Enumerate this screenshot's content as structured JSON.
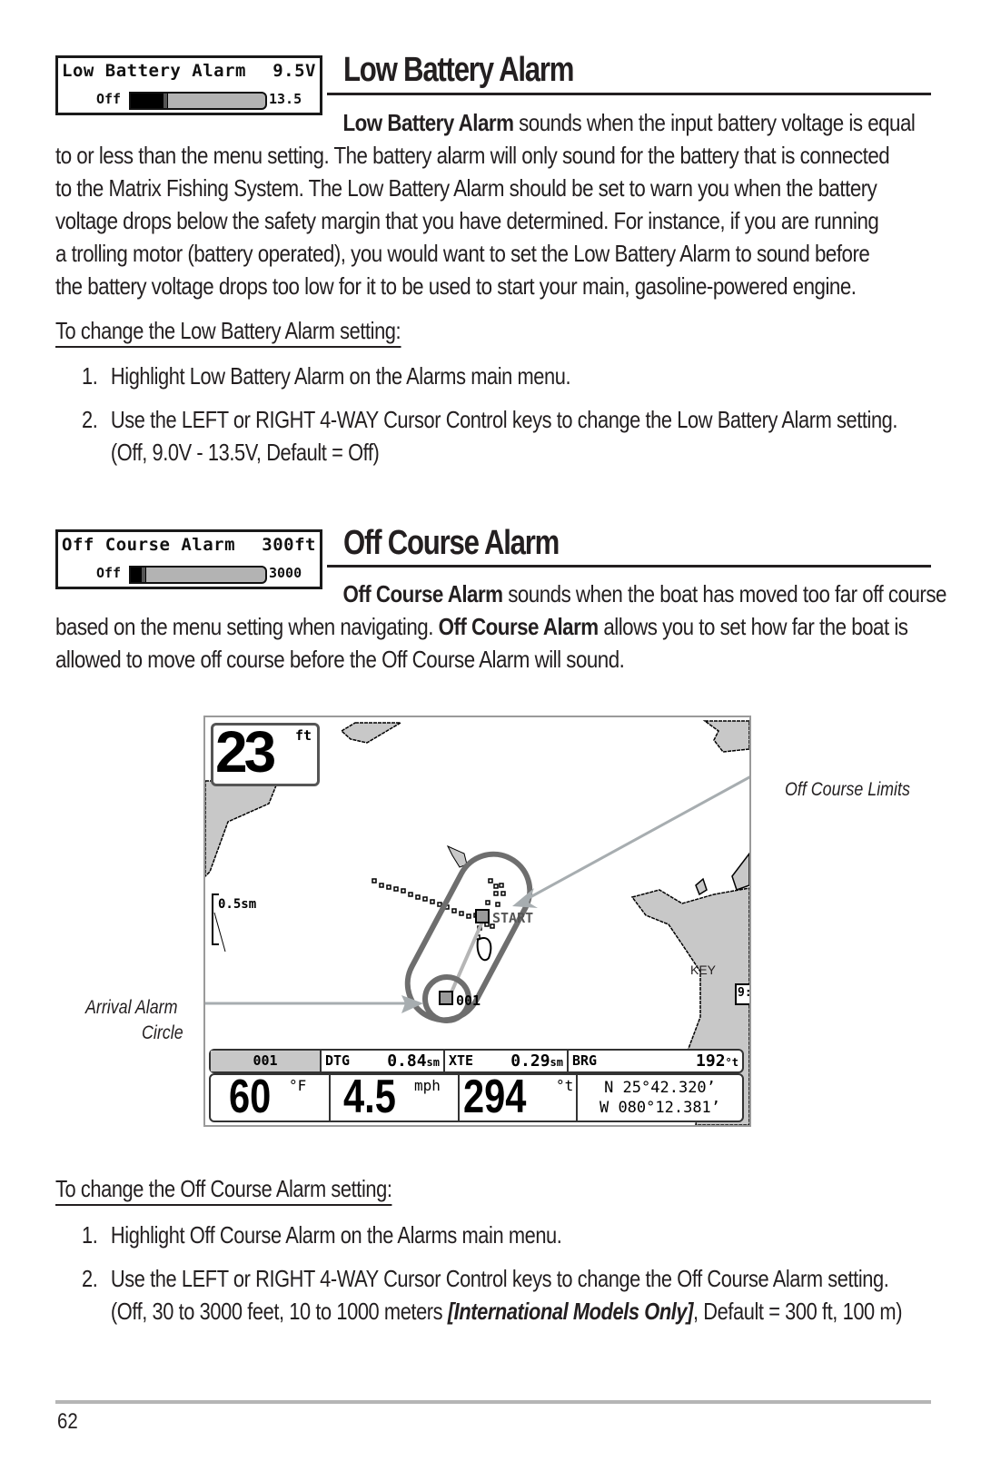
{
  "sections": {
    "low_battery": {
      "menu": {
        "title": "Low Battery Alarm",
        "value": "9.5V",
        "min_label": "Off",
        "max_label": "13.5",
        "slider_fraction": 0.25
      },
      "heading": "Low Battery Alarm",
      "intro_bold": "Low Battery Alarm",
      "intro_rest": " sounds when the input battery voltage is equal",
      "body_lines": [
        "to or less than the menu setting. The battery alarm will only sound for the battery that is connected",
        "to the  Matrix Fishing System. The Low Battery Alarm should be set to warn you when the battery",
        "voltage drops below the safety margin that you have determined. For instance, if you are running",
        "a trolling motor (battery operated), you would want to set the Low Battery Alarm to sound before",
        "the battery voltage drops too low for it to be used to start your main, gasoline-powered engine."
      ],
      "procedure_heading": "To change the Low Battery Alarm setting:",
      "steps": [
        {
          "num": "1.",
          "text": "Highlight Low Battery Alarm on the Alarms main menu."
        },
        {
          "num": "2.",
          "text": "Use the LEFT or RIGHT 4-WAY Cursor Control keys to change the Low Battery Alarm setting.",
          "cont": "(Off, 9.0V - 13.5V,  Default = Off)"
        }
      ]
    },
    "off_course": {
      "menu": {
        "title": "Off Course Alarm",
        "value": "300ft",
        "min_label": "Off",
        "max_label": "3000",
        "slider_fraction": 0.09
      },
      "heading": "Off Course Alarm",
      "intro_bold": "Off Course Alarm",
      "intro_rest": " sounds when the boat has moved too far off course",
      "line2_pre": "based on the menu setting when navigating. ",
      "line2_bold": "Off Course Alarm",
      "line2_post": " allows you to set how far the boat is",
      "line3": "allowed to move off course before the Off Course Alarm will sound.",
      "procedure_heading": "To change the Off Course Alarm setting:",
      "steps": [
        {
          "num": "1.",
          "text": "Highlight Off Course Alarm on the Alarms main  menu."
        },
        {
          "num": "2.",
          "text": "Use the LEFT or RIGHT 4-WAY Cursor Control keys to change the Off Course Alarm setting.",
          "cont_pre": "(Off, 30 to 3000 feet, 10 to 1000 meters ",
          "cont_italic": "[International Models Only]",
          "cont_post": ", Default = 300 ft, 100 m)"
        }
      ]
    }
  },
  "figure": {
    "callouts": {
      "off_course_limits": "Off Course Limits",
      "arrival_alarm_line1": "Arrival Alarm",
      "arrival_alarm_line2": "Circle"
    },
    "depth": {
      "value": "23",
      "unit": "ft"
    },
    "scale": "0.5sm",
    "labels": {
      "start": "START",
      "waypoint": "001",
      "key": "KEY",
      "edge": "9:"
    },
    "nav_bar": {
      "waypoint": "001",
      "dtg_label": "DTG",
      "dtg_value": "0.84",
      "dtg_unit": "sm",
      "xte_label": "XTE",
      "xte_value": "0.29",
      "xte_unit": "sm",
      "brg_label": "BRG",
      "brg_value": "192",
      "brg_unit": "°t"
    },
    "readouts": {
      "temp_value": "60",
      "temp_unit": "°F",
      "speed_value": "4.5",
      "speed_unit": "mph",
      "heading_value": "294",
      "heading_unit": "°t",
      "lat": "N 25°42.320’",
      "lon": "W 080°12.381’"
    }
  },
  "footer": {
    "page_number": "62"
  }
}
